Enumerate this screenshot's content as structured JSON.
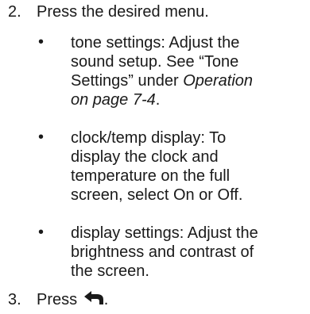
{
  "steps": [
    {
      "number": "2.",
      "text": "Press the desired menu."
    },
    {
      "number": "3.",
      "text_before": "Press",
      "icon": "back-arrow-icon",
      "text_after": "."
    }
  ],
  "bullet_marker": "•",
  "bullets": [
    {
      "lines": "tone settings: Adjust the\nsound setup. See “Tone\nSettings” under ",
      "italic": "Operation\non page 7‑4",
      "tail": "."
    },
    {
      "lines": "clock/temp display: To\ndisplay the clock and\ntemperature on the full\nscreen, select On or Off."
    },
    {
      "lines": "display settings: Adjust the\nbrightness and contrast of\nthe screen."
    }
  ]
}
